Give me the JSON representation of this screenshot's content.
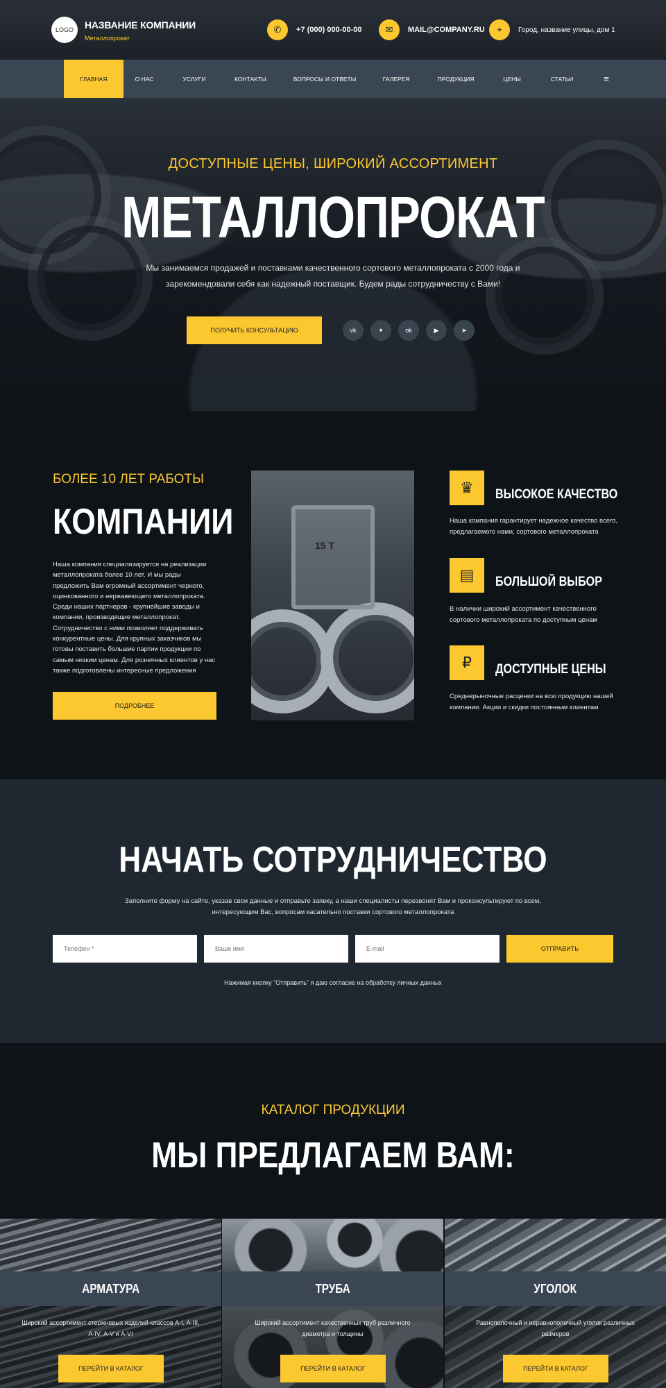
{
  "header": {
    "logo": "LOGO",
    "company_name": "НАЗВАНИЕ КОМПАНИИ",
    "company_sub": "Металлопрокат",
    "phone": "+7 (000) 000-00-00",
    "email": "MAIL@COMPANY.RU",
    "address": "Город, название улицы, дом 1"
  },
  "nav": {
    "items": [
      "ГЛАВНАЯ",
      "О НАС",
      "УСЛУГИ",
      "КОНТАКТЫ",
      "ВОПРОСЫ И ОТВЕТЫ",
      "ГАЛЕРЕЯ",
      "ПРОДУКЦИЯ",
      "ЦЕНЫ",
      "СТАТЬИ"
    ],
    "active": "ГЛАВНАЯ",
    "menu_icon": "≡"
  },
  "hero": {
    "kicker": "ДОСТУПНЫЕ ЦЕНЫ, ШИРОКИЙ АССОРТИМЕНТ",
    "title": "МЕТАЛЛОПРОКАТ",
    "text": "Мы занимаемся продажей и поставками качественного сортового металлопроката с 2000 года и зарекомендовали себя как надежный поставщик. Будем рады сотрудничеству с Вами!",
    "button": "ПОЛУЧИТЬ КОНСУЛЬТАЦИЮ",
    "social": [
      "vk-icon",
      "twitter-icon",
      "odnoklassniki-icon",
      "youtube-icon",
      "telegram-icon"
    ]
  },
  "about": {
    "kicker": "БОЛЕЕ 10 ЛЕТ РАБОТЫ",
    "title": "КОМПАНИИ",
    "text": "Наша компания специализируется на реализации металлопроката более 10 лет. И мы рады предложить Вам огромный ассортимент черного, оцинкованного и нержавеющего металлопроката. Среди наших партнеров - крупнейшие заводы и компании, производящие металлопрокат. Сотрудничество с ними позволяет поддерживать конкурентные цены. Для крупных заказчиков мы готовы поставить большие партии продукции по самым низким ценам. Для розничных клиентов у нас также подготовлены интересные предложения",
    "button": "ПОДРОБНЕЕ",
    "photo_label": "15 T",
    "features": [
      {
        "icon": "award-icon",
        "title": "ВЫСОКОЕ КАЧЕСТВО",
        "text": "Наша компания гарантирует надежное качество всего, предлагаемого нами, сортового металлопроката"
      },
      {
        "icon": "beams-icon",
        "title": "БОЛЬШОЙ ВЫБОР",
        "text": "В наличии широкий ассортимент качественного сортового металлопроката по доступным ценам"
      },
      {
        "icon": "ruble-coins-icon",
        "title": "ДОСТУПНЫЕ ЦЕНЫ",
        "text": "Среднерыночные расценки на всю продукцию нашей компании. Акции и скидки постоянным клиентам"
      }
    ]
  },
  "cta": {
    "title": "НАЧАТЬ СОТРУДНИЧЕСТВО",
    "text": "Заполните форму на сайте, указав свои данные и отправьте заявку, а наши специалисты перезвонят Вам и проконсультируют по всем, интересующим Вас, вопросам касательно поставки сортового металлопроката",
    "phone_placeholder": "Телефон *",
    "name_placeholder": "Ваше имя",
    "email_placeholder": "E-mail",
    "button": "ОТПРАВИТЬ",
    "note": "Нажимая кнопку \"Отправить\" я даю согласие на обработку личных данных"
  },
  "catalog": {
    "kicker": "КАТАЛОГ ПРОДУКЦИИ",
    "title": "МЫ ПРЕДЛАГАЕМ ВАМ:",
    "cards": [
      {
        "title": "АРМАТУРА",
        "text": "Широкий ассортимент стержневых изделий классов А-I, А-III, А-IV, А-V и А-VI",
        "button": "ПЕРЕЙТИ В КАТАЛОГ"
      },
      {
        "title": "ТРУБА",
        "text": "Широкий ассортимент качественных труб различного диаметра и толщины",
        "button": "ПЕРЕЙТИ В КАТАЛОГ"
      },
      {
        "title": "УГОЛОК",
        "text": "Равнополочный и неравнополочный уголок различных размеров",
        "button": "ПЕРЕЙТИ В КАТАЛОГ"
      }
    ]
  },
  "colors": {
    "accent": "#fcc830",
    "nav_bg": "#3b4654",
    "dark_bg": "#0e1318",
    "cta_bg": "#1f2730"
  }
}
